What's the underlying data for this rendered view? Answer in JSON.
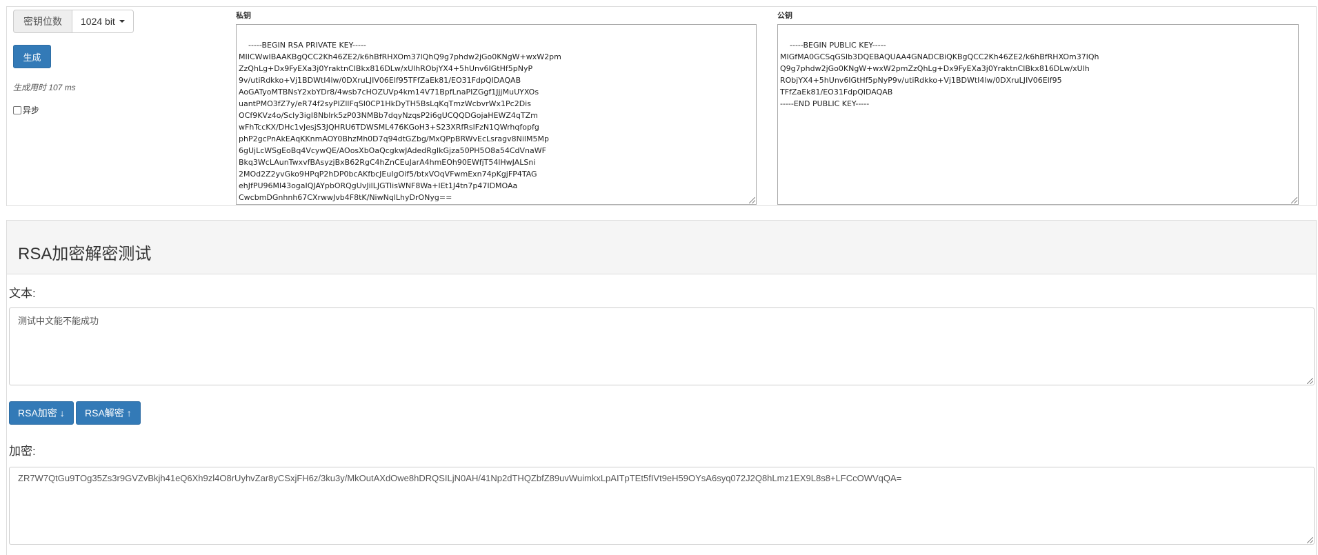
{
  "generator": {
    "keysize_label": "密钥位数",
    "keysize_value": "1024 bit",
    "generate_button": "生成",
    "gen_time": "生成用时 107 ms",
    "async_label": "异步",
    "private_label": "私钥",
    "public_label": "公钥",
    "private_key": "-----BEGIN RSA PRIVATE KEY-----\nMIICWwIBAAKBgQCC2Kh46ZE2/k6hBfRHXOm37lQhQ9g7phdw2jGo0KNgW+wxW2pm\nZzQhLg+Dx9FyEXa3j0YraktnCIBkx816DLw/xUlhRObjYX4+5hUnv6IGtHf5pNyP\n9v/utiRdkko+Vj1BDWtI4lw/0DXruLJIV06Elf95TFfZaEk81/EO31FdpQIDAQAB\nAoGATyoMTBNsY2xbYDr8/4wsb7cHOZUVp4km14V71BpfLnaPIZGgf1JjjMuUYXOs\nuantPMO3fZ7y/eR74f2syPIZllFqSI0CP1HkDyTH5BsLqKqTmzWcbvrWx1Pc2Dis\nOCf9KVz4o/Scly3igI8Nblrk5zP03NMBb7dqyNzqsP2i6gUCQQDGojaHEWZ4qTZm\nwFhTccKX/DHc1vJesjS3JQHRU6TDWSML476KGoH3+S23XRfRslFzN1QWrhqfopfg\nphP2gcPnAkEAqKKnmAOY0BhzMh0D7q94dtGZbg/MxQPpBRWvEcLsragv8NilM5Mp\n6gUjLcWSgEoBq4VcywQE/AOosXbOaQcgkwJAdedRgIkGjza50PH5O8a54CdVnaWF\nBkq3WcLAunTwxvfBAsyzjBxB62RgC4hZnCEuJarA4hmEOh90EWfjT54lHwJALSni\n2MOd2Z2yvGko9HPqP2hDP0bcAKfbcJEuIgOif5/btxVOqVFwmExn74pKgjFP4TAG\nehJfPU96Ml43ogaIQJAYpbORQgUvJilLJGTIisWNF8Wa+lEt1J4tn7p47IDMOAa\nCwcbmDGnhnh67CXrwwJvb4F8tK/NiwNqlLhyDrONyg==\n-----END RSA PRIVATE KEY-----",
    "public_key": "-----BEGIN PUBLIC KEY-----\nMIGfMA0GCSqGSIb3DQEBAQUAA4GNADCBiQKBgQCC2Kh46ZE2/k6hBfRHXOm37lQh\nQ9g7phdw2jGo0KNgW+wxW2pmZzQhLg+Dx9FyEXa3j0YraktnCIBkx816DLw/xUlh\nRObjYX4+5hUnv6IGtHf5pNyP9v/utiRdkko+Vj1BDWtI4lw/0DXruLJIV06Elf95\nTFfZaEk81/EO31FdpQIDAQAB\n-----END PUBLIC KEY-----"
  },
  "test": {
    "title": "RSA加密解密测试",
    "text_label": "文本:",
    "text_value": "测试中文能不能成功",
    "encrypt_button": "RSA加密",
    "encrypt_arrow": "↓",
    "decrypt_button": "RSA解密",
    "decrypt_arrow": "↑",
    "cipher_label": "加密:",
    "cipher_value": "ZR7W7QtGu9TOg35Zs3r9GVZvBkjh41eQ6Xh9zl4O8rUyhvZar8yCSxjFH6z/3ku3y/MkOutAXdOwe8hDRQSILjN0AH/41Np2dTHQZbfZ89uvWuimkxLpAITpTEt5fIVt9eH59OYsA6syq072J2Q8hLmz1EX9L8s8+LFCcOWVqQA="
  },
  "colors": {
    "primary": "#337ab7",
    "panel_heading_bg": "#f5f5f5",
    "border": "#dddddd"
  }
}
